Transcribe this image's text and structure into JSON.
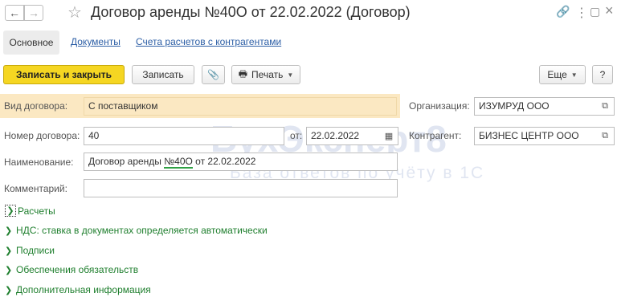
{
  "window": {
    "title": "Договор аренды №40О от 22.02.2022 (Договор)",
    "back_icon": "←",
    "forward_icon": "→",
    "star_icon": "☆",
    "link_icon": "🔗",
    "more_icon": "⋮",
    "restore_icon": "▢",
    "close_icon": "×"
  },
  "tabs": [
    {
      "label": "Основное"
    },
    {
      "label": "Документы"
    },
    {
      "label": "Счета расчетов с контрагентами"
    }
  ],
  "toolbar": {
    "save_close": "Записать и закрыть",
    "save": "Записать",
    "attach_icon": "📎",
    "print_icon": "🖶",
    "print": "Печать",
    "more": "Еще",
    "help": "?"
  },
  "form": {
    "contract_type_label": "Вид договора:",
    "contract_type_value": "С поставщиком",
    "organization_label": "Организация:",
    "organization_value": "ИЗУМРУД ООО",
    "number_label": "Номер договора:",
    "number_value": "40",
    "date_label": "от:",
    "date_value": "22.02.2022",
    "counterparty_label": "Контрагент:",
    "counterparty_value": "БИЗНЕС ЦЕНТР ООО",
    "name_label": "Наименование:",
    "name_prefix": "Договор аренды ",
    "name_number": "№40О",
    "name_suffix": " от 22.02.2022",
    "comment_label": "Комментарий:",
    "comment_value": ""
  },
  "groups": [
    {
      "label": "Расчеты"
    },
    {
      "label": "НДС: ставка в документах определяется автоматически"
    },
    {
      "label": "Подписи"
    },
    {
      "label": "Обеспечения обязательств"
    },
    {
      "label": "Дополнительная информация"
    }
  ],
  "watermark": {
    "brand": "БухЭксперт8",
    "tagline": "База ответов по учёту в 1С"
  }
}
